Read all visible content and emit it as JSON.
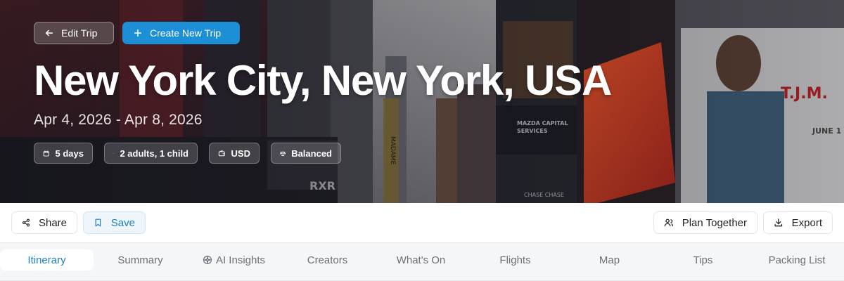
{
  "hero": {
    "edit_label": "Edit Trip",
    "create_label": "Create New Trip",
    "title": "New York City, New York, USA",
    "dates": "Apr 4, 2026 - Apr 8, 2026",
    "chips": [
      {
        "icon": "calendar-icon",
        "label": "5 days"
      },
      {
        "icon": "users-icon",
        "label": "2 adults, 1 child"
      },
      {
        "icon": "wallet-icon",
        "label": "USD"
      },
      {
        "icon": "scale-icon",
        "label": "Balanced"
      }
    ],
    "billboards": [
      "MADAME",
      "MAZDA CAPITAL SERVICES",
      "T.J.M.",
      "CHASE",
      "RXR"
    ]
  },
  "actions": {
    "share_label": "Share",
    "save_label": "Save",
    "plan_label": "Plan Together",
    "export_label": "Export"
  },
  "tabs": [
    {
      "label": "Itinerary",
      "active": true
    },
    {
      "label": "Summary"
    },
    {
      "label": "AI Insights",
      "icon": "sparkle-icon"
    },
    {
      "label": "Creators"
    },
    {
      "label": "What's On"
    },
    {
      "label": "Flights"
    },
    {
      "label": "Map"
    },
    {
      "label": "Tips"
    },
    {
      "label": "Packing List"
    }
  ],
  "colors": {
    "accent": "#1c8fd6",
    "active_tab_text": "#1b7fc4",
    "save_bg": "#eef6fc"
  }
}
